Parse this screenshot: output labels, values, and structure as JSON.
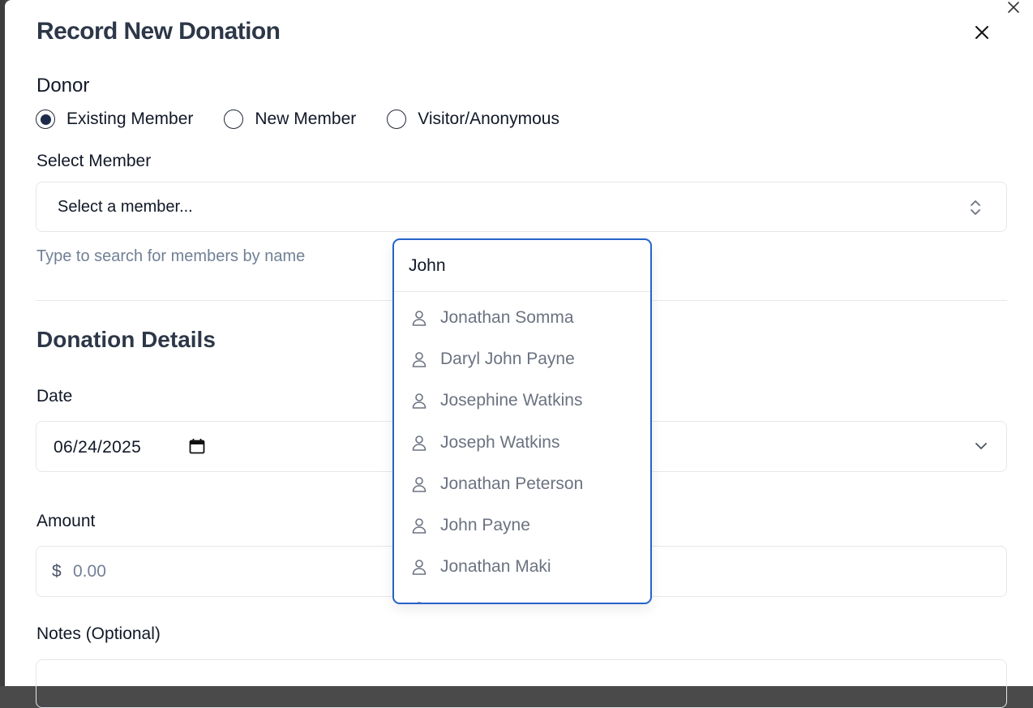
{
  "modal": {
    "title": "Record New Donation"
  },
  "donor": {
    "label": "Donor",
    "options": [
      {
        "label": "Existing Member",
        "checked": true
      },
      {
        "label": "New Member",
        "checked": false
      },
      {
        "label": "Visitor/Anonymous",
        "checked": false
      }
    ]
  },
  "member_select": {
    "label": "Select Member",
    "value": "Select a member...",
    "helper": "Type to search for members by name"
  },
  "dropdown": {
    "search_value": "John",
    "results": [
      "Jonathan Somma",
      "Daryl John Payne",
      "Josephine Watkins",
      "Joseph Watkins",
      "Jonathan Peterson",
      "John Payne",
      "Jonathan Maki"
    ]
  },
  "details": {
    "section_title": "Donation Details",
    "date_label": "Date",
    "date_value": "06/24/2025",
    "amount_label": "Amount",
    "currency_symbol": "$",
    "amount_placeholder": "0.00",
    "notes_label": "Notes (Optional)"
  },
  "colors": {
    "accent": "#2563c9",
    "radio_checked": "#1e2a4a",
    "helper_text": "#718096"
  },
  "icons": {
    "close": "close-icon",
    "chevron": "chevron-up-down-icon",
    "calendar": "calendar-icon",
    "user": "user-icon"
  }
}
